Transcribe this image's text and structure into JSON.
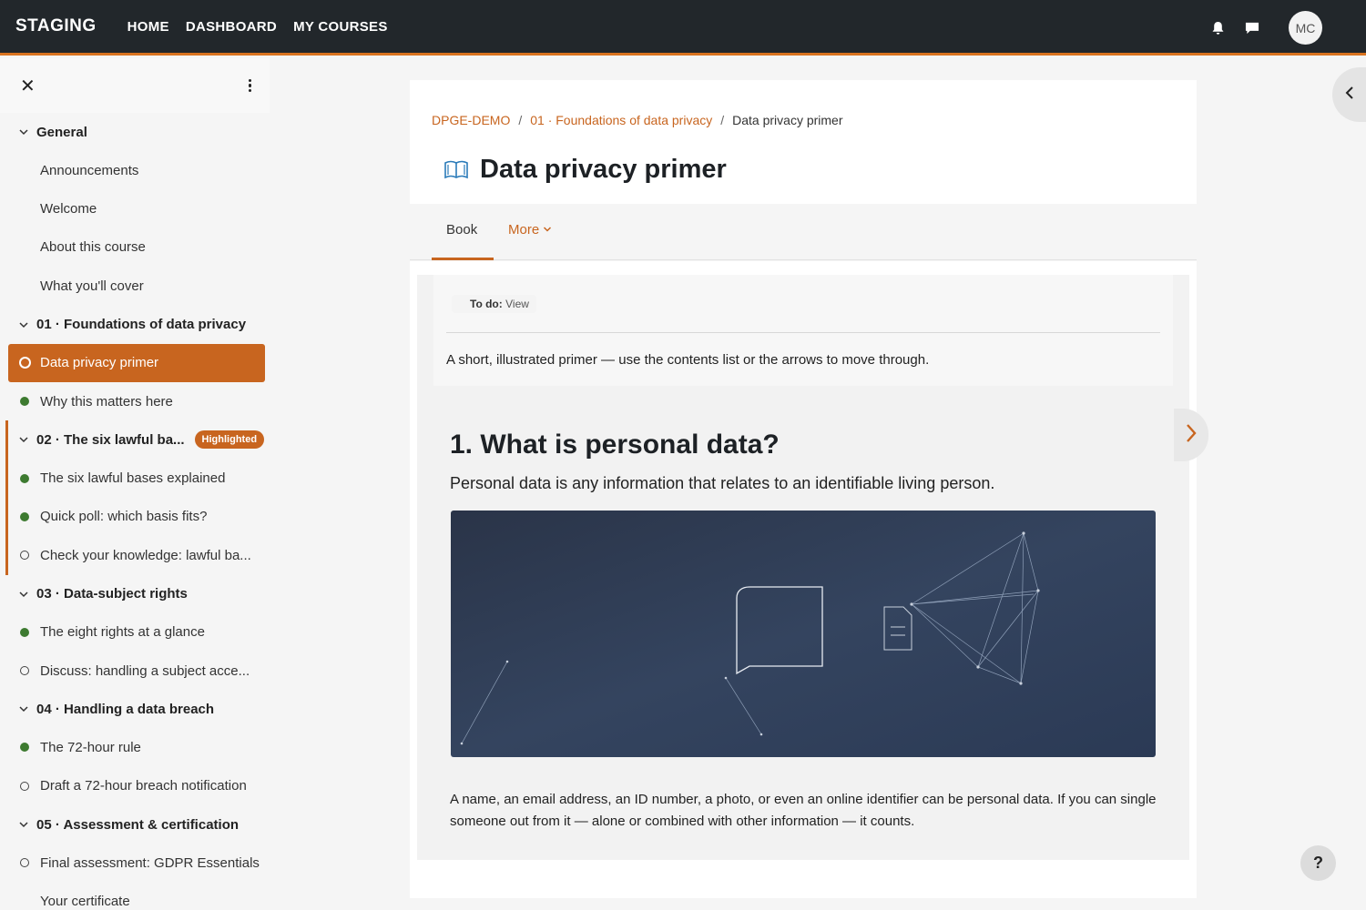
{
  "navbar": {
    "brand": "STAGING",
    "links": [
      "HOME",
      "DASHBOARD",
      "MY COURSES"
    ],
    "avatar_initials": "MC",
    "accent_color": "#d9731f"
  },
  "drawer": {
    "sections": [
      {
        "title": "General",
        "items": [
          {
            "label": "Announcements",
            "status": "none"
          },
          {
            "label": "Welcome",
            "status": "none"
          },
          {
            "label": "About this course",
            "status": "none"
          },
          {
            "label": "What you'll cover",
            "status": "none"
          }
        ]
      },
      {
        "title": "01 · Foundations of data privacy",
        "items": [
          {
            "label": "Data privacy primer",
            "status": "current"
          },
          {
            "label": "Why this matters here",
            "status": "done"
          }
        ]
      },
      {
        "title": "02 · The six lawful ba...",
        "badge": "Highlighted",
        "items": [
          {
            "label": "The six lawful bases explained",
            "status": "done"
          },
          {
            "label": "Quick poll: which basis fits?",
            "status": "done"
          },
          {
            "label": "Check your knowledge: lawful ba...",
            "status": "todo"
          }
        ]
      },
      {
        "title": "03 · Data-subject rights",
        "items": [
          {
            "label": "The eight rights at a glance",
            "status": "done"
          },
          {
            "label": "Discuss: handling a subject acce...",
            "status": "todo"
          }
        ]
      },
      {
        "title": "04 · Handling a data breach",
        "items": [
          {
            "label": "The 72-hour rule",
            "status": "done"
          },
          {
            "label": "Draft a 72-hour breach notification",
            "status": "todo"
          }
        ]
      },
      {
        "title": "05 · Assessment & certification",
        "items": [
          {
            "label": "Final assessment: GDPR Essentials",
            "status": "todo"
          },
          {
            "label": "Your certificate",
            "status": "none"
          }
        ]
      }
    ]
  },
  "breadcrumb": {
    "course": "DPGE-DEMO",
    "section": "01 · Foundations of data privacy",
    "current": "Data privacy primer",
    "separator": "/"
  },
  "page": {
    "title": "Data privacy primer"
  },
  "secondary_nav": {
    "tabs": [
      "Book",
      "More"
    ]
  },
  "activity": {
    "todo_label": "To do:",
    "todo_value": "View",
    "intro": "A short, illustrated primer — use the contents list or the arrows to move through."
  },
  "chapter": {
    "title": "1. What is personal data?",
    "subtitle": "Personal data is any information that relates to an identifiable living person.",
    "body": "A name, an email address, an ID number, a photo, or even an online identifier can be personal data. If you can single someone out from it — alone or combined with other information — it counts."
  },
  "help": {
    "label": "?"
  }
}
